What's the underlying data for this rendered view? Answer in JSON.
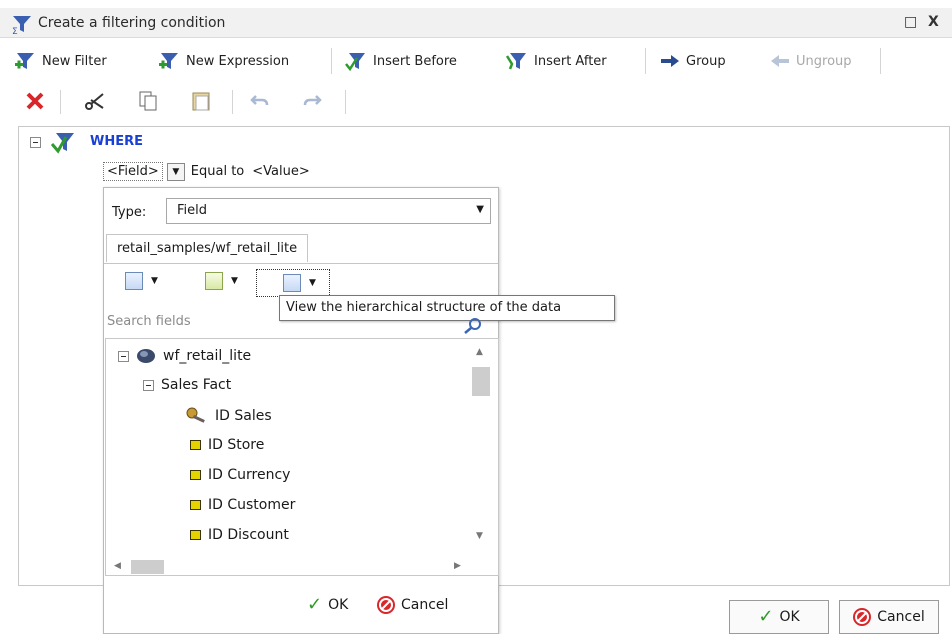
{
  "window": {
    "title": "Create a filtering condition",
    "restore_glyph": "□",
    "close_glyph": "X"
  },
  "toolbar": {
    "new_filter": "New Filter",
    "new_expression": "New Expression",
    "insert_before": "Insert Before",
    "insert_after": "Insert After",
    "group": "Group",
    "ungroup": "Ungroup"
  },
  "condition": {
    "where_label": "WHERE",
    "field_placeholder": "<Field>",
    "operator": "Equal to",
    "value_placeholder": "<Value>"
  },
  "popup": {
    "type_label": "Type:",
    "type_value": "Field",
    "tab_label": "retail_samples/wf_retail_lite",
    "tooltip": "View the hierarchical structure of the data",
    "search_placeholder": "Search fields",
    "ok_label": "OK",
    "cancel_label": "Cancel"
  },
  "tree": {
    "root": "wf_retail_lite",
    "group": "Sales Fact",
    "items": [
      "ID Sales",
      "ID Store",
      "ID Currency",
      "ID Customer",
      "ID Discount"
    ]
  },
  "dialog": {
    "ok_label": "OK",
    "cancel_label": "Cancel"
  },
  "colors": {
    "where_blue": "#1a3fd4",
    "delete_red": "#d8262a",
    "check_green": "#2f9a27"
  }
}
